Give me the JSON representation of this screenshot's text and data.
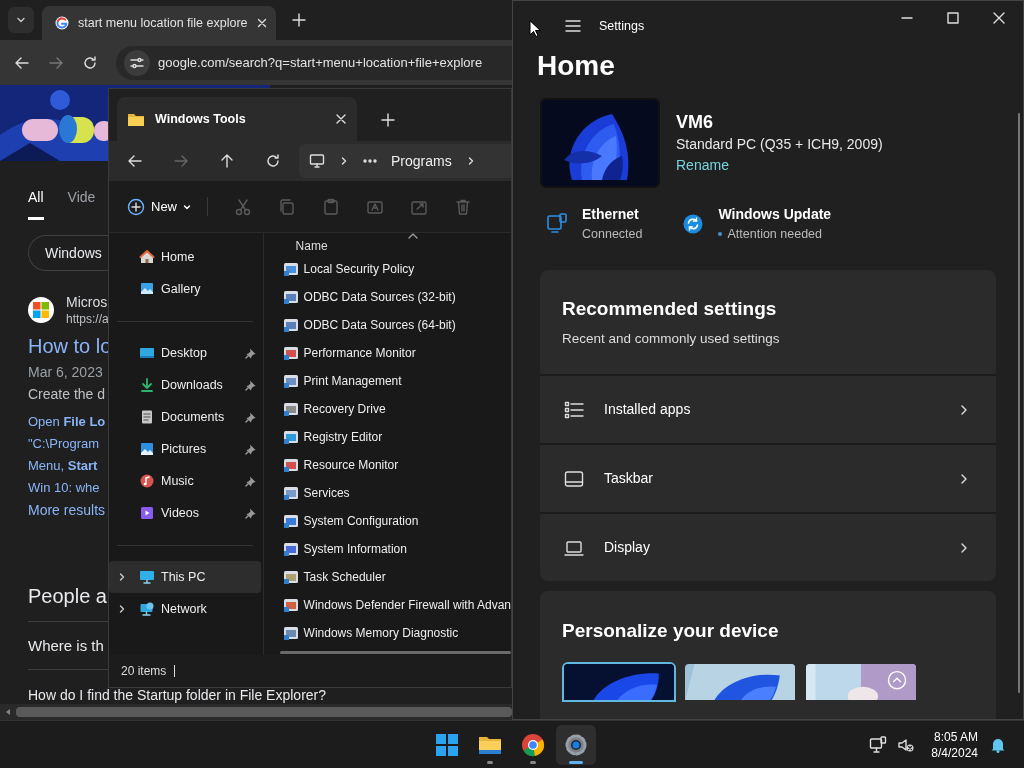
{
  "browser": {
    "tab": {
      "title": "start menu location file explore"
    },
    "address": "google.com/search?q=start+menu+location+file+explore",
    "search_tabs": [
      {
        "label": "All",
        "selected": true
      },
      {
        "label": "Vide",
        "selected": false
      }
    ],
    "chips": [
      "Windows"
    ],
    "result": {
      "site": "Micros",
      "url": "https://a",
      "title": "How to lo",
      "date": "Mar 6, 2023",
      "snippet": "Create the d",
      "lines": [
        "Open **File Lo**",
        "\"C:\\Program",
        "Menu, **Start**",
        "Win 10: whe"
      ],
      "more": "More results"
    },
    "people_also_ask": {
      "title": "People a",
      "questions": [
        "Where is th",
        "How do I find the Startup folder in File Explorer?"
      ]
    }
  },
  "explorer": {
    "tab_title": "Windows Tools",
    "breadcrumb": "Programs",
    "new_label": "New",
    "commands": [
      {
        "kind": "cut",
        "disabled": true
      },
      {
        "kind": "copy",
        "disabled": true
      },
      {
        "kind": "paste",
        "disabled": true
      },
      {
        "kind": "rename",
        "disabled": true
      },
      {
        "kind": "share",
        "disabled": true
      },
      {
        "kind": "delete",
        "disabled": true
      }
    ],
    "sidebar": [
      {
        "items": [
          {
            "label": "Home",
            "kind": "home",
            "pinned": false,
            "selected": false,
            "expandable": false
          },
          {
            "label": "Gallery",
            "kind": "gallery",
            "pinned": false,
            "selected": false,
            "expandable": false
          }
        ]
      },
      {
        "items": [
          {
            "label": "Desktop",
            "kind": "desktop",
            "pinned": true,
            "selected": false,
            "expandable": false
          },
          {
            "label": "Downloads",
            "kind": "downloads",
            "pinned": true,
            "selected": false,
            "expandable": false
          },
          {
            "label": "Documents",
            "kind": "documents",
            "pinned": true,
            "selected": false,
            "expandable": false
          },
          {
            "label": "Pictures",
            "kind": "pictures",
            "pinned": true,
            "selected": false,
            "expandable": false
          },
          {
            "label": "Music",
            "kind": "music",
            "pinned": true,
            "selected": false,
            "expandable": false
          },
          {
            "label": "Videos",
            "kind": "videos",
            "pinned": true,
            "selected": false,
            "expandable": false
          }
        ]
      },
      {
        "items": [
          {
            "label": "This PC",
            "kind": "pc",
            "pinned": false,
            "selected": true,
            "expandable": true
          },
          {
            "label": "Network",
            "kind": "network",
            "pinned": false,
            "selected": false,
            "expandable": true
          }
        ]
      }
    ],
    "column": "Name",
    "files": [
      "Local Security Policy",
      "ODBC Data Sources (32-bit)",
      "ODBC Data Sources (64-bit)",
      "Performance Monitor",
      "Print Management",
      "Recovery Drive",
      "Registry Editor",
      "Resource Monitor",
      "Services",
      "System Configuration",
      "System Information",
      "Task Scheduler",
      "Windows Defender Firewall with Advan",
      "Windows Memory Diagnostic"
    ],
    "status": "20 items"
  },
  "settings": {
    "title": "Settings",
    "heading": "Home",
    "device": {
      "name": "VM6",
      "model": "Standard PC (Q35 + ICH9, 2009)",
      "rename": "Rename"
    },
    "status": [
      {
        "kind": "ethernet",
        "title": "Ethernet",
        "detail": "Connected",
        "alert": false
      },
      {
        "kind": "update",
        "title": "Windows Update",
        "detail": "Attention needed",
        "alert": true
      }
    ],
    "recommended": {
      "title": "Recommended settings",
      "subtitle": "Recent and commonly used settings",
      "items": [
        {
          "kind": "apps",
          "label": "Installed apps"
        },
        {
          "kind": "taskbar",
          "label": "Taskbar"
        },
        {
          "kind": "display",
          "label": "Display"
        }
      ]
    },
    "personalize": {
      "title": "Personalize your device",
      "themes": [
        {
          "kind": "dark",
          "selected": true
        },
        {
          "kind": "light",
          "selected": false
        },
        {
          "kind": "flowers",
          "selected": false
        }
      ]
    }
  },
  "taskbar": {
    "apps": [
      {
        "kind": "start",
        "active": false
      },
      {
        "kind": "explorer",
        "active": false
      },
      {
        "kind": "chrome",
        "active": false
      },
      {
        "kind": "settings",
        "active": true
      }
    ],
    "time": "8:05 AM",
    "date": "8/4/2024"
  }
}
